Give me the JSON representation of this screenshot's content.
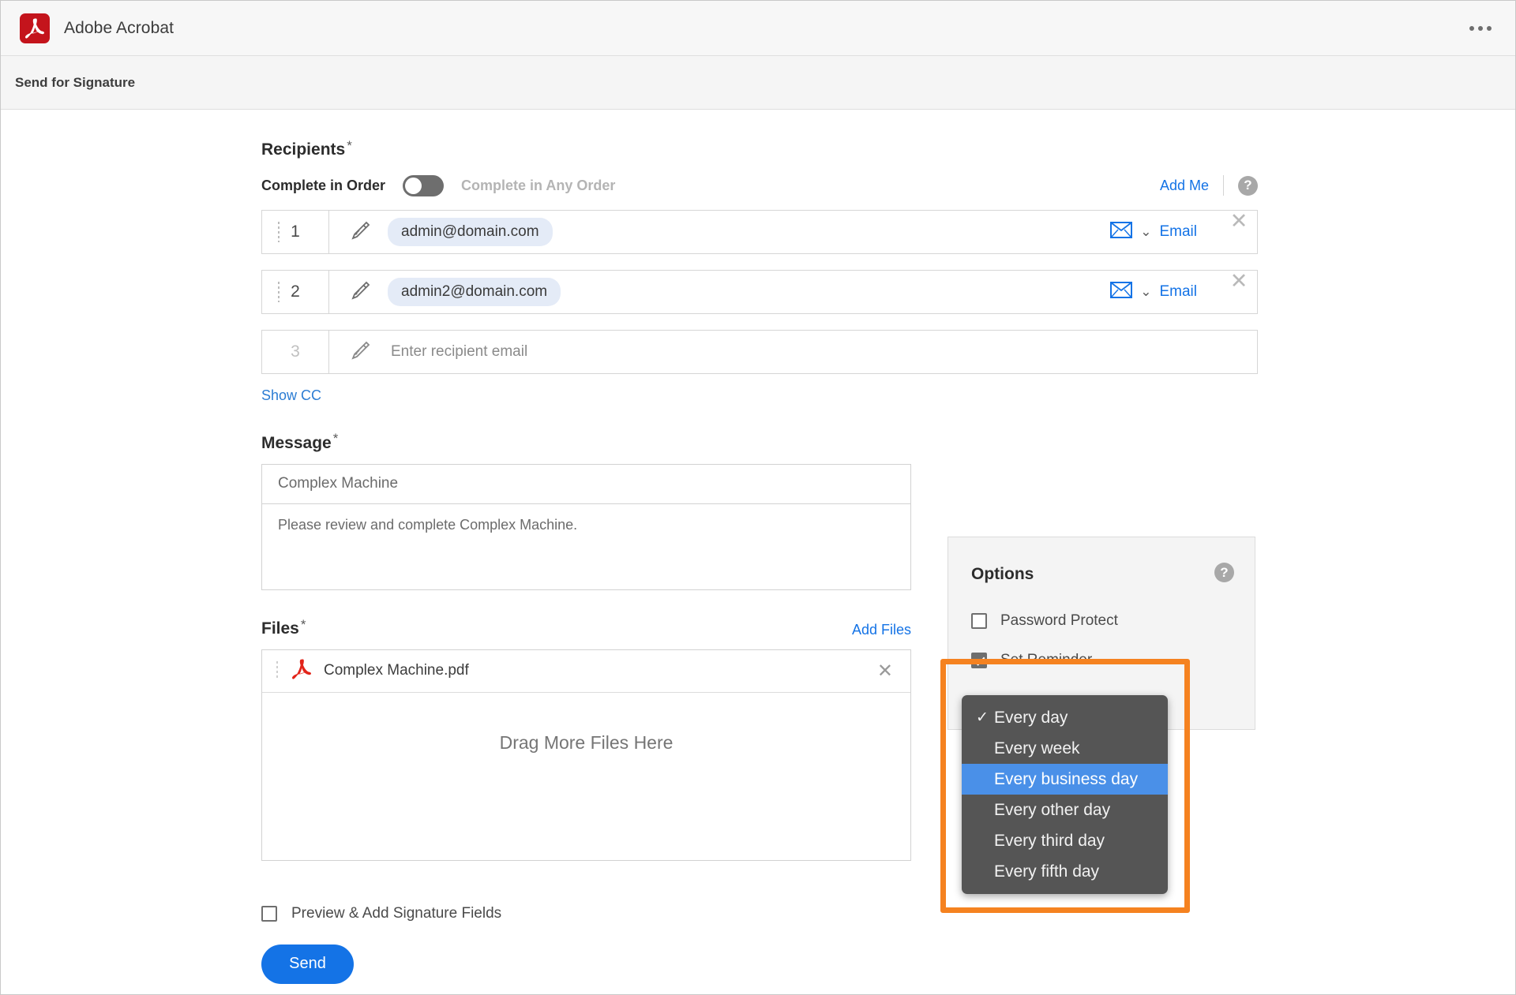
{
  "titlebar": {
    "app_name": "Adobe Acrobat",
    "logo_icon": "adobe-acrobat-logo",
    "overflow_icon": "more-horizontal-icon"
  },
  "subheader": {
    "title": "Send for Signature"
  },
  "recipients": {
    "heading": "Recipients",
    "required_mark": "*",
    "order_label": "Complete in Order",
    "order_label_any": "Complete in Any Order",
    "toggle_state": "off",
    "add_me_label": "Add Me",
    "help_icon_glyph": "?",
    "rows": [
      {
        "index": "1",
        "email": "admin@domain.com",
        "placeholder": "",
        "role": "Email",
        "delivery_icon": "envelope-icon",
        "chevron": "⌄",
        "close": "✕",
        "has_value": true
      },
      {
        "index": "2",
        "email": "admin2@domain.com",
        "placeholder": "",
        "role": "Email",
        "delivery_icon": "envelope-icon",
        "chevron": "⌄",
        "close": "✕",
        "has_value": true
      },
      {
        "index": "3",
        "email": "",
        "placeholder": "Enter recipient email",
        "role": "",
        "delivery_icon": "",
        "chevron": "",
        "close": "",
        "has_value": false
      }
    ],
    "show_cc_label": "Show CC"
  },
  "message": {
    "heading": "Message",
    "required_mark": "*",
    "subject_value": "Complex Machine",
    "body_value": "Please review and complete Complex Machine."
  },
  "files": {
    "heading": "Files",
    "required_mark": "*",
    "add_files_label": "Add Files",
    "items": [
      {
        "name": "Complex Machine.pdf",
        "icon": "pdf-icon",
        "remove": "✕"
      }
    ],
    "dropzone_label": "Drag More Files Here"
  },
  "footer": {
    "preview_label": "Preview & Add Signature Fields",
    "preview_checked": false,
    "send_label": "Send"
  },
  "options": {
    "title": "Options",
    "help_icon_glyph": "?",
    "password_protect": {
      "label": "Password Protect",
      "checked": false
    },
    "set_reminder": {
      "label": "Set Reminder",
      "checked": true
    }
  },
  "reminder_dropdown": {
    "items": [
      {
        "label": "Every day",
        "checked": true,
        "highlighted": false
      },
      {
        "label": "Every week",
        "checked": false,
        "highlighted": false
      },
      {
        "label": "Every business day",
        "checked": false,
        "highlighted": true
      },
      {
        "label": "Every other day",
        "checked": false,
        "highlighted": false
      },
      {
        "label": "Every third day",
        "checked": false,
        "highlighted": false
      },
      {
        "label": "Every fifth day",
        "checked": false,
        "highlighted": false
      }
    ],
    "check_glyph": "✓"
  },
  "colors": {
    "accent_blue": "#1473e6",
    "highlight_orange": "#f58220",
    "selection_blue": "#4a90e8",
    "adobe_red": "#c4141c",
    "menu_gray": "#555555"
  }
}
